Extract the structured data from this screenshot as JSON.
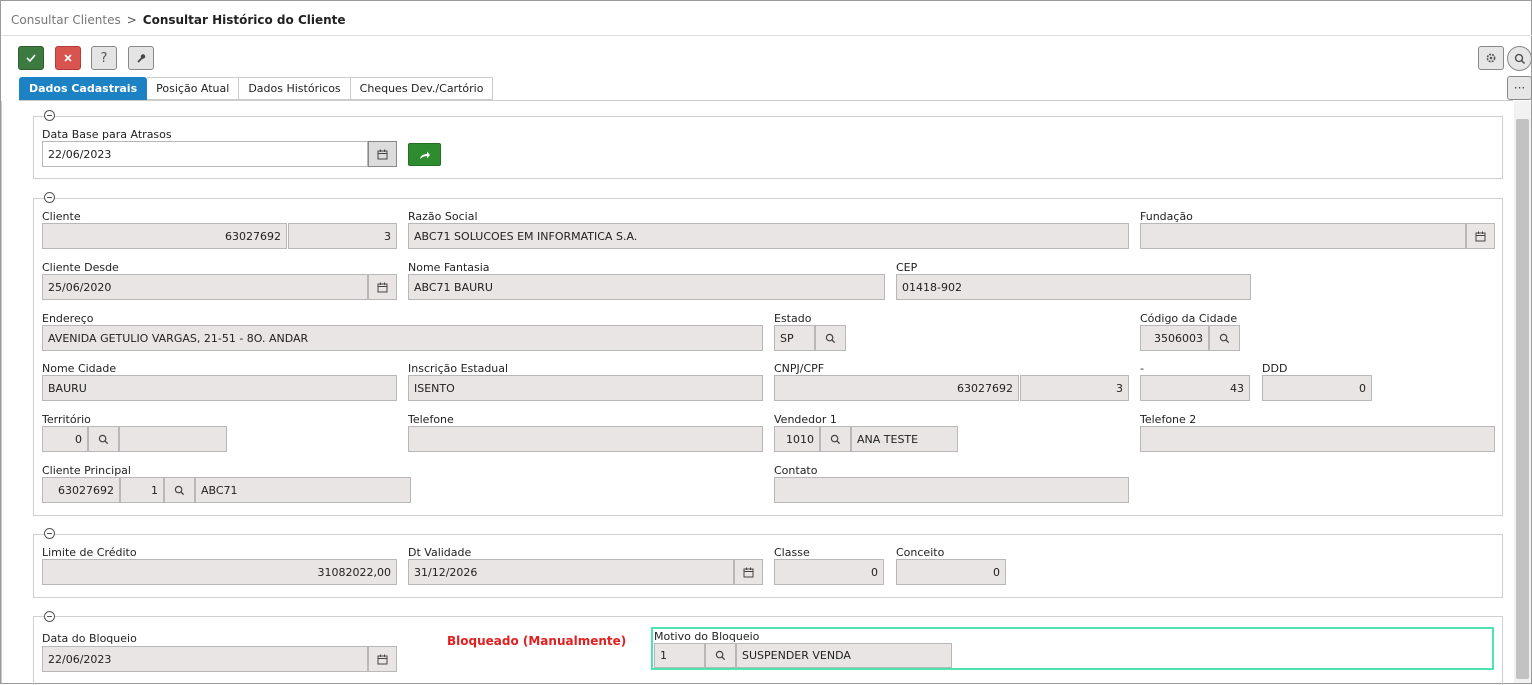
{
  "breadcrumb": {
    "root": "Consultar Clientes",
    "separator": ">",
    "current": "Consultar Histórico do Cliente"
  },
  "toolbar": {
    "help_label": "?"
  },
  "right_buttons": {
    "more_label": "···"
  },
  "tabs": [
    {
      "label": "Dados Cadastrais",
      "active": true
    },
    {
      "label": "Posição Atual",
      "active": false
    },
    {
      "label": "Dados Históricos",
      "active": false
    },
    {
      "label": "Cheques Dev./Cartório",
      "active": false
    }
  ],
  "section_base": {
    "label": "Data Base para Atrasos",
    "value": "22/06/2023"
  },
  "cadastro": {
    "cliente": {
      "label": "Cliente",
      "code": "63027692",
      "seq": "3"
    },
    "razao_social": {
      "label": "Razão Social",
      "value": "ABC71 SOLUCOES EM INFORMATICA S.A."
    },
    "fundacao": {
      "label": "Fundação",
      "value": ""
    },
    "cliente_desde": {
      "label": "Cliente Desde",
      "value": "25/06/2020"
    },
    "nome_fantasia": {
      "label": "Nome Fantasia",
      "value": "ABC71 BAURU"
    },
    "cep": {
      "label": "CEP",
      "value": "01418-902"
    },
    "endereco": {
      "label": "Endereço",
      "value": "AVENIDA GETULIO VARGAS, 21-51 - 8O. ANDAR"
    },
    "estado": {
      "label": "Estado",
      "value": "SP"
    },
    "codigo_cidade": {
      "label": "Código da Cidade",
      "value": "3506003"
    },
    "nome_cidade": {
      "label": "Nome Cidade",
      "value": "BAURU"
    },
    "inscricao_estadual": {
      "label": "Inscrição Estadual",
      "value": "ISENTO"
    },
    "cnpj": {
      "label": "CNPJ/CPF",
      "value": "63027692",
      "seq": "3"
    },
    "dash": {
      "label": "-",
      "value": "43"
    },
    "ddd": {
      "label": "DDD",
      "value": "0"
    },
    "territorio": {
      "label": "Território",
      "value": "0",
      "desc": ""
    },
    "telefone": {
      "label": "Telefone",
      "value": ""
    },
    "vendedor1": {
      "label": "Vendedor 1",
      "code": "1010",
      "name": "ANA TESTE"
    },
    "telefone2": {
      "label": "Telefone 2",
      "value": ""
    },
    "cliente_principal": {
      "label": "Cliente Principal",
      "code": "63027692",
      "seq": "1",
      "name": "ABC71"
    },
    "contato": {
      "label": "Contato",
      "value": ""
    }
  },
  "credito": {
    "limite": {
      "label": "Limite de Crédito",
      "value": "31082022,00"
    },
    "dt_validade": {
      "label": "Dt Validade",
      "value": "31/12/2026"
    },
    "classe": {
      "label": "Classe",
      "value": "0"
    },
    "conceito": {
      "label": "Conceito",
      "value": "0"
    }
  },
  "bloqueio": {
    "data": {
      "label": "Data do Bloqueio",
      "value": "22/06/2023"
    },
    "status": "Bloqueado (Manualmente)",
    "motivo": {
      "label": "Motivo do Bloqueio",
      "code": "1",
      "desc": "SUSPENDER VENDA"
    }
  },
  "colors": {
    "accent": "#1d82c4",
    "ok": "#3c7a3f",
    "cancel": "#d9534f",
    "blocked": "#e02020",
    "highlight": "#4fe3b0"
  },
  "icons": [
    "check-icon",
    "close-icon",
    "help-icon",
    "wrench-icon",
    "gear-icon",
    "search-icon",
    "more-icon",
    "calendar-icon",
    "arrow-forward-icon",
    "collapse-icon"
  ]
}
